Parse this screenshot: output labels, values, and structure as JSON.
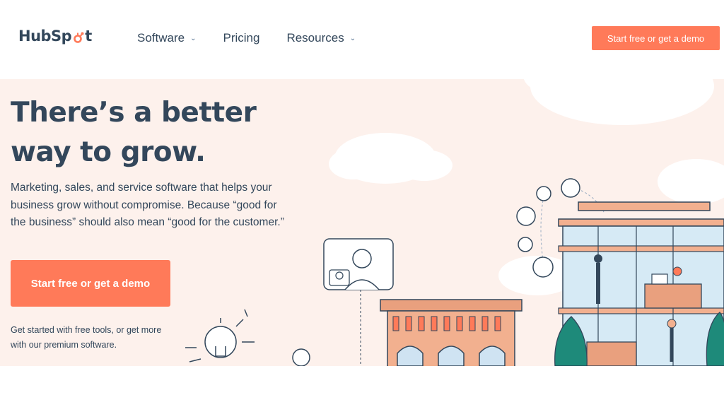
{
  "brand": {
    "name_left": "HubSp",
    "name_right": "t",
    "accent": "#ff7a59",
    "text": "#33475b",
    "hero_bg": "#fdf1ec"
  },
  "nav": {
    "items": [
      {
        "label": "Software",
        "has_dropdown": true
      },
      {
        "label": "Pricing",
        "has_dropdown": false
      },
      {
        "label": "Resources",
        "has_dropdown": true
      }
    ],
    "cta": "Start free or get a demo"
  },
  "hero": {
    "title": "There’s a better way to grow.",
    "description": "Marketing, sales, and service software that helps your business grow without compromise. Because “good for the business” should also mean “good for the customer.”",
    "cta": "Start free or get a demo",
    "note": "Get started with free tools, or get more with our premium software."
  },
  "icons": [
    "hubspot-sprocket-icon",
    "chevron-down-icon",
    "lightbulb-icon",
    "video-call-icon",
    "avatar-icon"
  ]
}
